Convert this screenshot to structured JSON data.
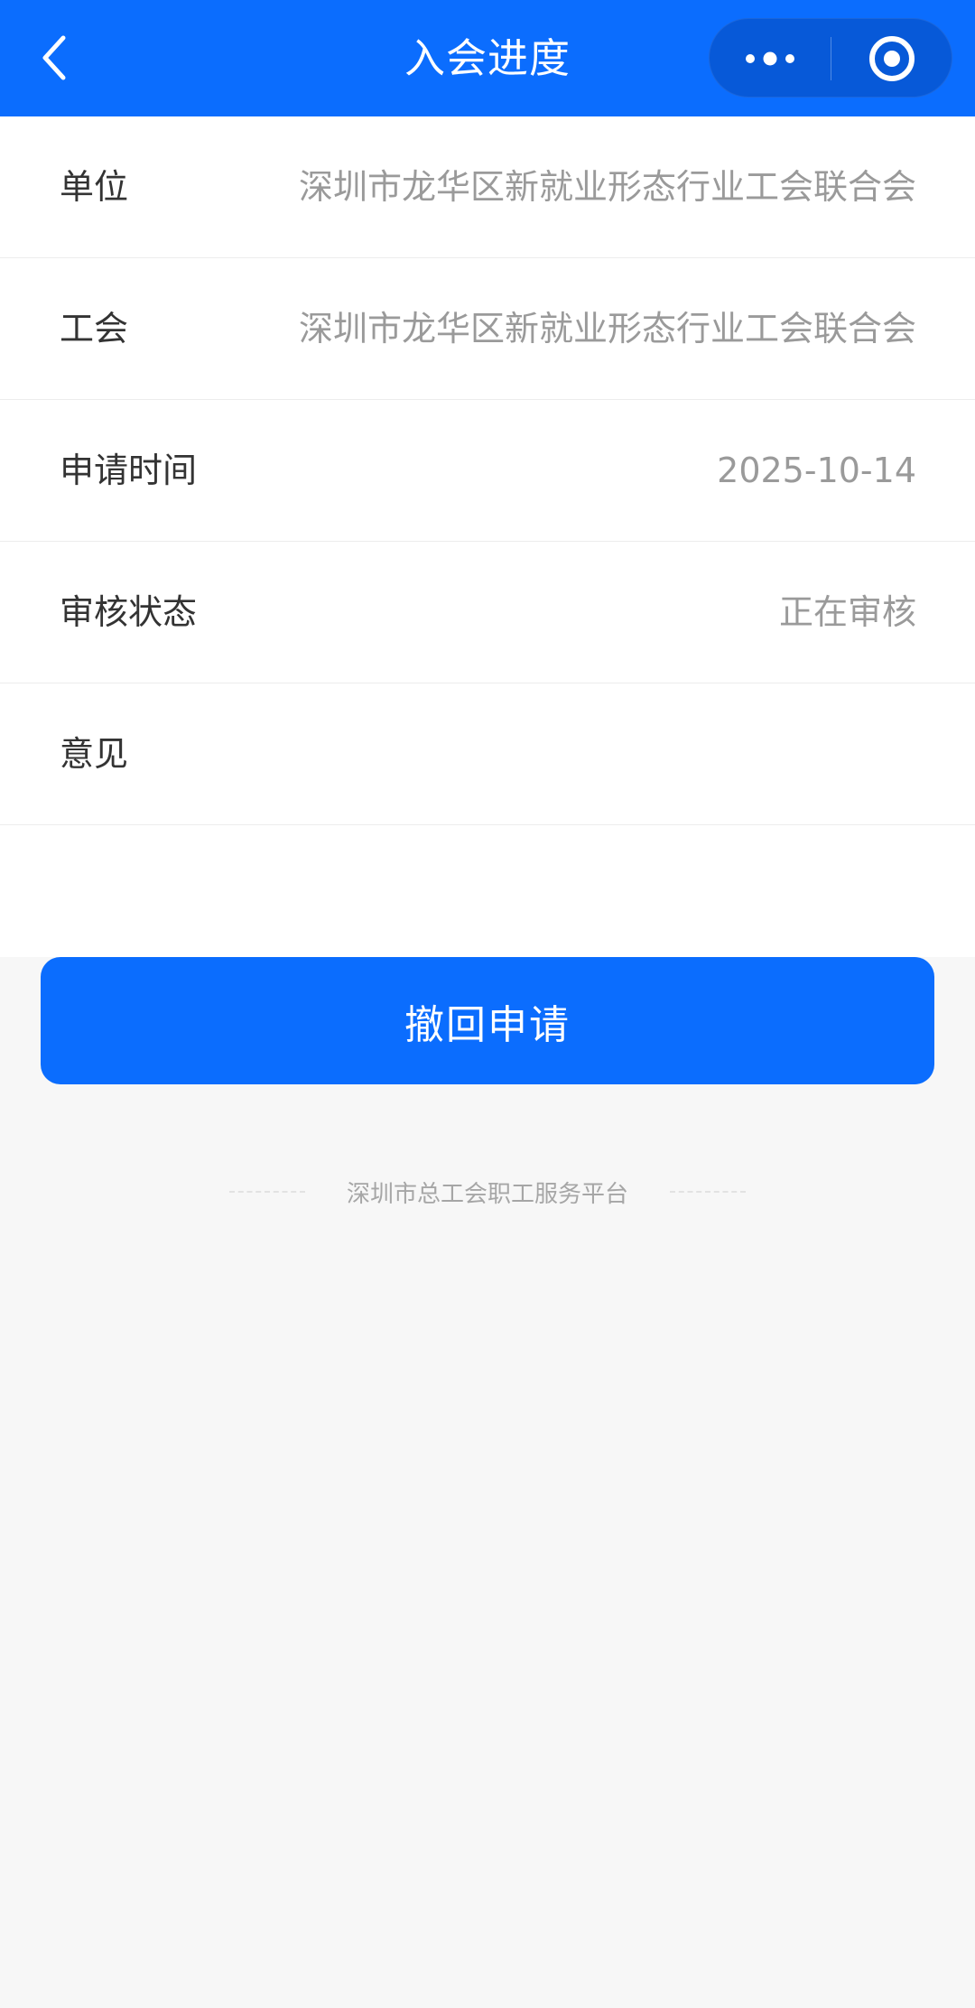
{
  "header": {
    "title": "入会进度",
    "back_icon": "chevron-left-icon",
    "more_icon": "more-dots-icon",
    "close_icon": "target-close-icon",
    "background_color": "#0b6dfe"
  },
  "details": {
    "rows": [
      {
        "label": "单位",
        "value": "深圳市龙华区新就业形态行业工会联合会"
      },
      {
        "label": "工会",
        "value": "深圳市龙华区新就业形态行业工会联合会"
      },
      {
        "label": "申请时间",
        "value": "2025-10-14"
      },
      {
        "label": "审核状态",
        "value": "正在审核"
      },
      {
        "label": "意见",
        "value": ""
      }
    ]
  },
  "actions": {
    "withdraw_label": "撤回申请",
    "button_color": "#0b6dfe"
  },
  "footer": {
    "text": "深圳市总工会职工服务平台"
  }
}
